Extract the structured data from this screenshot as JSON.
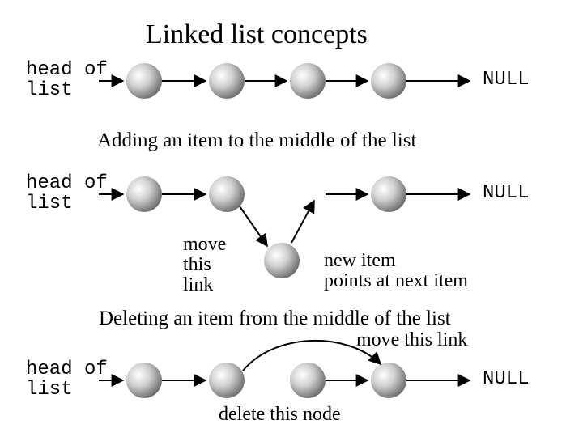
{
  "title": "Linked list concepts",
  "row1": {
    "head_label": "head of\nlist",
    "null_label": "NULL"
  },
  "caption_add": "Adding an item to the middle of the list",
  "row2": {
    "head_label": "head of\nlist",
    "null_label": "NULL",
    "move_label": "move\nthis\nlink",
    "new_label": "new item\npoints at next item"
  },
  "caption_del": "Deleting an item from the middle of the list",
  "row3": {
    "move_link_label": "move this link",
    "head_label": "head of\nlist",
    "null_label": "NULL",
    "delete_label": "delete this node"
  }
}
